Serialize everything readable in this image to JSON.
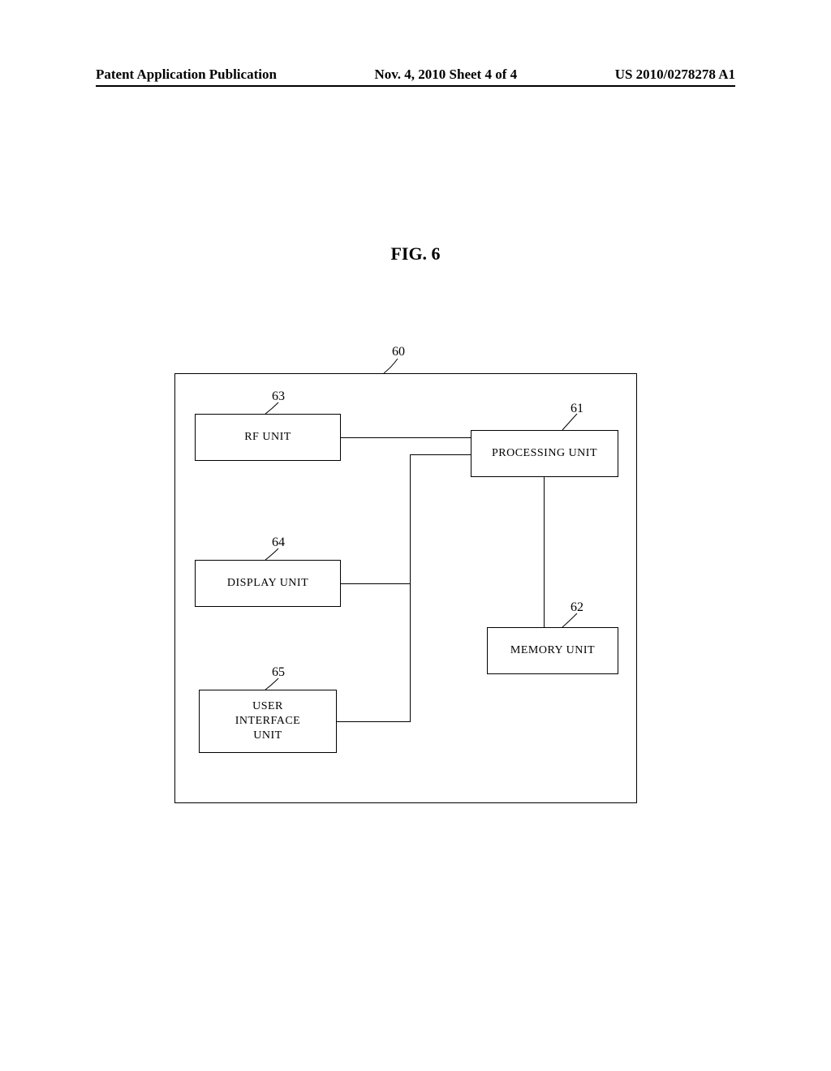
{
  "header": {
    "left": "Patent Application Publication",
    "center": "Nov. 4, 2010  Sheet 4 of 4",
    "right": "US 2010/0278278 A1"
  },
  "figure_label": "FIG. 6",
  "refs": {
    "r60": "60",
    "r61": "61",
    "r62": "62",
    "r63": "63",
    "r64": "64",
    "r65": "65"
  },
  "blocks": {
    "rf_unit": "RF   UNIT",
    "processing_unit": "PROCESSING UNIT",
    "display_unit": "DISPLAY UNIT",
    "memory_unit": "MEMORY UNIT",
    "ui_unit": "USER\nINTERFACE\nUNIT"
  }
}
